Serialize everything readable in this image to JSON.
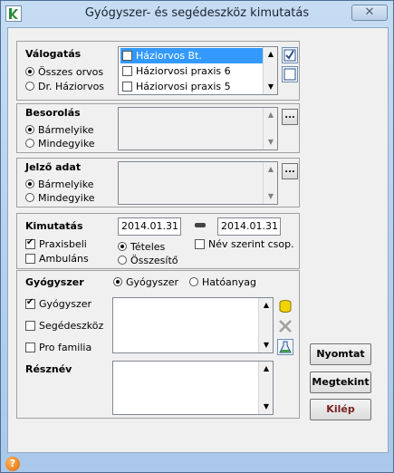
{
  "window": {
    "title": "Gyógyszer- és segédeszköz kimutatás",
    "close_glyph": "✕"
  },
  "valogatas": {
    "label": "Válogatás",
    "radio1": "Összes orvos",
    "radio2": "Dr. Háziorvos",
    "items": [
      "Háziorvos Bt.",
      "Háziorvosi praxis 6",
      "Háziorvosi praxis 5"
    ]
  },
  "besorolas": {
    "label": "Besorolás",
    "radio1": "Bármelyike",
    "radio2": "Mindegyike",
    "btn": "..."
  },
  "jelzo": {
    "label": "Jelző adat",
    "radio1": "Bármelyike",
    "radio2": "Mindegyike",
    "btn": "..."
  },
  "kimutatas": {
    "label": "Kimutatás",
    "date_from": "2014.01.31",
    "date_to": "2014.01.31",
    "praxisbeli": "Praxisbeli",
    "ambulans": "Ambuláns",
    "teteles": "Tételes",
    "osszesito": "Összesítő",
    "nev_szerint": "Név szerint csop."
  },
  "gyogyszer": {
    "label": "Gyógyszer",
    "radio1": "Gyógyszer",
    "radio2": "Hatóanyag",
    "check1": "Gyógyszer",
    "check2": "Segédeszköz",
    "check3": "Pro familia",
    "reszne_label": "Résznév"
  },
  "buttons": {
    "nyomtat": "Nyomtat",
    "megtekint": "Megtekint",
    "kilep": "Kilép"
  },
  "status": {
    "help_glyph": "?"
  },
  "colors": {
    "selected": "#3399ff",
    "title_bg": "#b8d3ef"
  }
}
